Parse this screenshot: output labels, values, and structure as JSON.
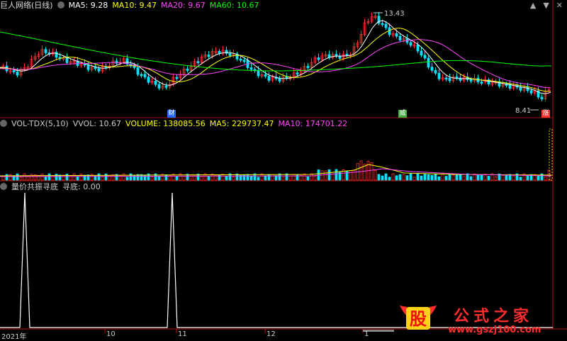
{
  "header": {
    "title": "巨人网络(日线)",
    "indicators": [
      {
        "label": "MA5: 9.28",
        "color": "#ffffff"
      },
      {
        "label": "MA10: 9.47",
        "color": "#ffff00"
      },
      {
        "label": "MA20: 9.67",
        "color": "#ff44ff"
      },
      {
        "label": "MA60: 10.67",
        "color": "#00ff00"
      }
    ],
    "controls": [
      "▲",
      "▼",
      "✕"
    ]
  },
  "price_panel": {
    "high_label": "13.43",
    "low_label": "8.41",
    "badges": [
      {
        "text": "财",
        "color": "#2266ff"
      },
      {
        "text": "威",
        "color": "#44aa44"
      },
      {
        "text": "涨",
        "color": "#ff3030"
      }
    ]
  },
  "volume_panel": {
    "indicators": [
      {
        "label": "VOL-TDX(5,10)",
        "color": "#cccccc"
      },
      {
        "label": "VVOL: 10.67",
        "color": "#cccccc"
      },
      {
        "label": "VOLUME: 138085.56",
        "color": "#ffff00"
      },
      {
        "label": "MA5: 229737.47",
        "color": "#ffff00"
      },
      {
        "label": "MA10: 174701.22",
        "color": "#ff44ff"
      }
    ]
  },
  "signal_panel": {
    "indicators": [
      {
        "label": "量价共振寻底",
        "color": "#cccccc"
      },
      {
        "label": "寻底: 0.00",
        "color": "#cccccc"
      }
    ]
  },
  "time_axis": {
    "labels": [
      "2021年",
      "10",
      "11",
      "12",
      "1"
    ]
  },
  "watermark": {
    "logo_char": "股",
    "site_name": "公式之家",
    "url": "www.gszj100.com"
  },
  "colors": {
    "up": "#ff3030",
    "down": "#00e5ff",
    "ma5": "#ffffff",
    "ma10": "#ffff00",
    "ma20": "#ff44ff",
    "ma60": "#00ff00",
    "border": "#b01010"
  },
  "chart_data": {
    "type": "candlestick",
    "series": [
      {
        "name": "MA5",
        "values": [
          9.28
        ]
      },
      {
        "name": "MA10",
        "values": [
          9.47
        ]
      },
      {
        "name": "MA20",
        "values": [
          9.67
        ]
      },
      {
        "name": "MA60",
        "values": [
          10.67
        ]
      }
    ],
    "price_high": 13.43,
    "price_low": 8.41,
    "volume_current": 138085.56,
    "volume_ma5": 229737.47,
    "volume_ma10": 174701.22,
    "signal_value": 0.0
  }
}
